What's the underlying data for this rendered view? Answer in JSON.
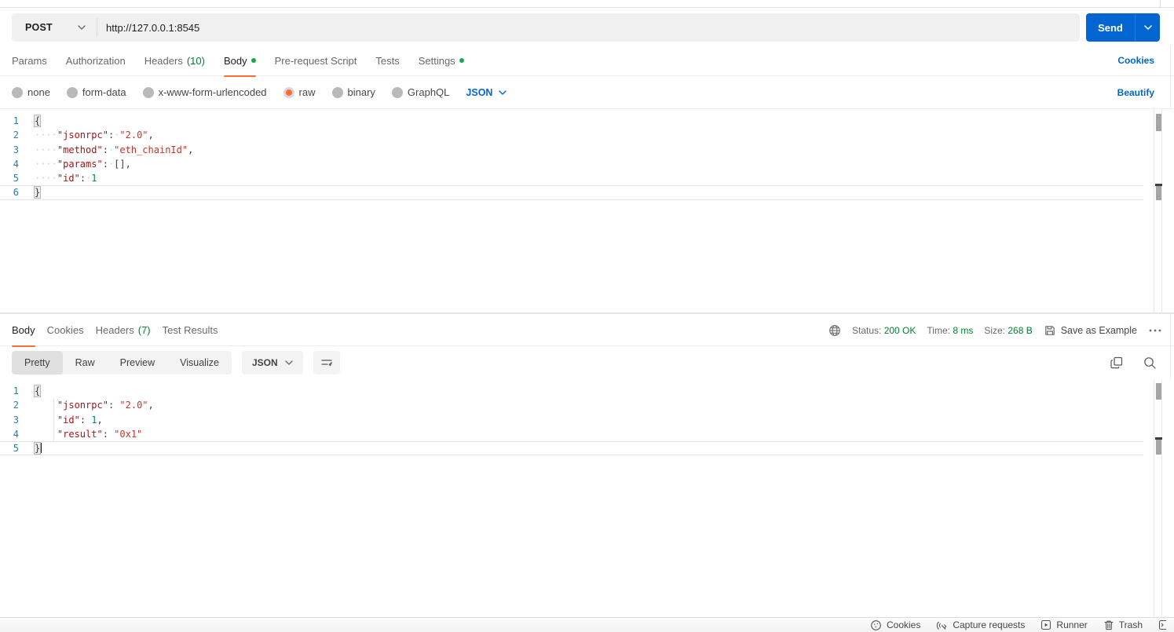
{
  "colors": {
    "accent_orange": "#ff6c37",
    "link_blue": "#0265d2",
    "success_green": "#007f31",
    "send_blue": "#0265d2"
  },
  "url_bar": {
    "method": "POST",
    "url": "http://127.0.0.1:8545",
    "send_label": "Send"
  },
  "request_tabs": {
    "params": "Params",
    "authorization": "Authorization",
    "headers": "Headers",
    "headers_count": "(10)",
    "body": "Body",
    "pre_request": "Pre-request Script",
    "tests": "Tests",
    "settings": "Settings",
    "cookies_link": "Cookies"
  },
  "body_type": {
    "none": "none",
    "form_data": "form-data",
    "urlencoded": "x-www-form-urlencoded",
    "raw": "raw",
    "binary": "binary",
    "graphql": "GraphQL",
    "language": "JSON",
    "beautify_link": "Beautify"
  },
  "request_editor": {
    "lines": [
      {
        "n": 1,
        "tokens": [
          [
            "b",
            "{"
          ]
        ]
      },
      {
        "n": 2,
        "tokens": [
          [
            "w",
            "····"
          ],
          [
            "k",
            "\"jsonrpc\""
          ],
          [
            "p",
            ":"
          ],
          [
            "w",
            "·"
          ],
          [
            "s",
            "\"2.0\""
          ],
          [
            "p",
            ","
          ]
        ]
      },
      {
        "n": 3,
        "tokens": [
          [
            "w",
            "····"
          ],
          [
            "k",
            "\"method\""
          ],
          [
            "p",
            ":"
          ],
          [
            "w",
            "·"
          ],
          [
            "s",
            "\"eth_chainId\""
          ],
          [
            "p",
            ","
          ]
        ]
      },
      {
        "n": 4,
        "tokens": [
          [
            "w",
            "····"
          ],
          [
            "k",
            "\"params\""
          ],
          [
            "p",
            ":"
          ],
          [
            "w",
            "·"
          ],
          [
            "p",
            "[],"
          ]
        ]
      },
      {
        "n": 5,
        "tokens": [
          [
            "w",
            "····"
          ],
          [
            "k",
            "\"id\""
          ],
          [
            "p",
            ":"
          ],
          [
            "w",
            "·"
          ],
          [
            "n",
            "1"
          ]
        ]
      },
      {
        "n": 6,
        "tokens": [
          [
            "b",
            "}"
          ]
        ],
        "active": true
      }
    ]
  },
  "response": {
    "tabs": {
      "body": "Body",
      "cookies": "Cookies",
      "headers": "Headers",
      "headers_count": "(7)",
      "test_results": "Test Results"
    },
    "meta": {
      "status_label": "Status:",
      "status_value": "200 OK",
      "time_label": "Time:",
      "time_value": "8 ms",
      "size_label": "Size:",
      "size_value": "268 B",
      "save_as_example": "Save as Example"
    },
    "view_modes": {
      "pretty": "Pretty",
      "raw": "Raw",
      "preview": "Preview",
      "visualize": "Visualize",
      "language": "JSON"
    },
    "editor": {
      "lines": [
        {
          "n": 1,
          "tokens": [
            [
              "b",
              "{"
            ]
          ]
        },
        {
          "n": 2,
          "tokens": [
            [
              "p",
              "    "
            ],
            [
              "k",
              "\"jsonrpc\""
            ],
            [
              "p",
              ": "
            ],
            [
              "s",
              "\"2.0\""
            ],
            [
              "p",
              ","
            ]
          ]
        },
        {
          "n": 3,
          "tokens": [
            [
              "p",
              "    "
            ],
            [
              "k",
              "\"id\""
            ],
            [
              "p",
              ": "
            ],
            [
              "n",
              "1"
            ],
            [
              "p",
              ","
            ]
          ]
        },
        {
          "n": 4,
          "tokens": [
            [
              "p",
              "    "
            ],
            [
              "k",
              "\"result\""
            ],
            [
              "p",
              ": "
            ],
            [
              "s",
              "\"0x1\""
            ]
          ]
        },
        {
          "n": 5,
          "tokens": [
            [
              "b",
              "}"
            ]
          ],
          "active": true,
          "cursor": true
        }
      ]
    }
  },
  "footer": {
    "cookies": "Cookies",
    "capture": "Capture requests",
    "runner": "Runner",
    "trash": "Trash"
  }
}
